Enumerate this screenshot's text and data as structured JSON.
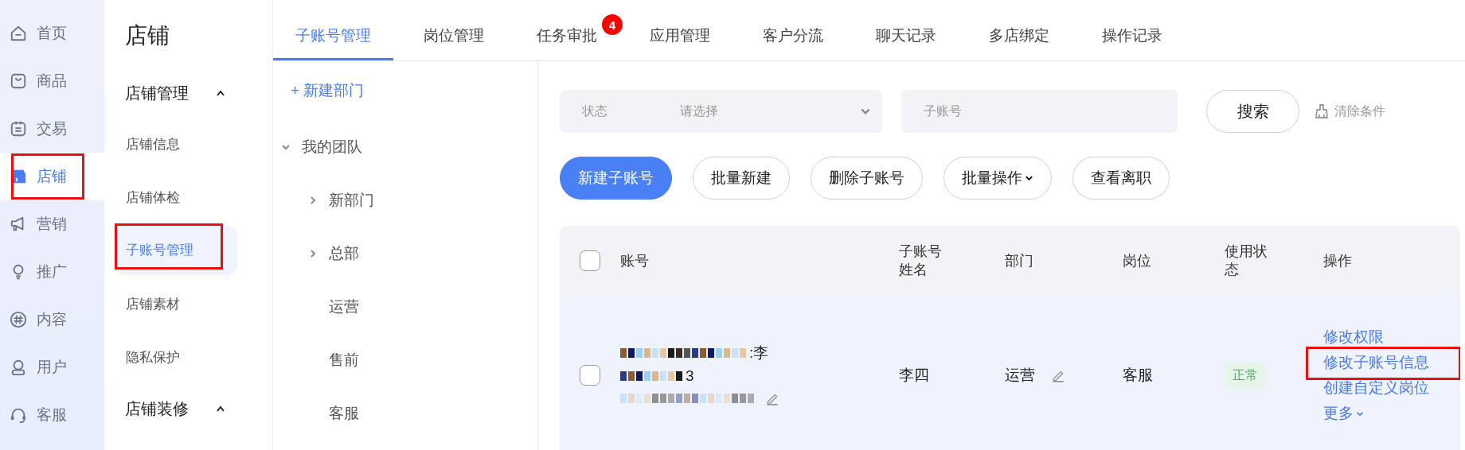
{
  "nav": [
    {
      "label": "首页",
      "selected": false,
      "highlighted": false
    },
    {
      "label": "商品",
      "selected": false,
      "highlighted": false
    },
    {
      "label": "交易",
      "selected": false,
      "highlighted": false
    },
    {
      "label": "店铺",
      "selected": true,
      "highlighted": true
    },
    {
      "label": "营销",
      "selected": false,
      "highlighted": false
    },
    {
      "label": "推广",
      "selected": false,
      "highlighted": false
    },
    {
      "label": "内容",
      "selected": false,
      "highlighted": false
    },
    {
      "label": "用户",
      "selected": false,
      "highlighted": false
    },
    {
      "label": "客服",
      "selected": false,
      "highlighted": false
    }
  ],
  "submenu": {
    "title": "店铺",
    "groups": [
      {
        "label": "店铺管理",
        "expanded": true,
        "items": [
          {
            "label": "店铺信息",
            "selected": false,
            "highlighted": false
          },
          {
            "label": "店铺体检",
            "selected": false,
            "highlighted": false
          },
          {
            "label": "子账号管理",
            "selected": true,
            "highlighted": true
          },
          {
            "label": "店铺素材",
            "selected": false,
            "highlighted": false
          },
          {
            "label": "隐私保护",
            "selected": false,
            "highlighted": false
          }
        ]
      },
      {
        "label": "店铺装修",
        "expanded": true
      }
    ]
  },
  "tabs": [
    {
      "label": "子账号管理",
      "selected": true
    },
    {
      "label": "岗位管理",
      "selected": false
    },
    {
      "label": "任务审批",
      "selected": false,
      "badge": "4"
    },
    {
      "label": "应用管理",
      "selected": false
    },
    {
      "label": "客户分流",
      "selected": false
    },
    {
      "label": "聊天记录",
      "selected": false
    },
    {
      "label": "多店绑定",
      "selected": false
    },
    {
      "label": "操作记录",
      "selected": false
    }
  ],
  "tree": {
    "add_label": "+ 新建部门",
    "root": {
      "label": "我的团队",
      "expanded": true,
      "children": [
        {
          "label": "新部门",
          "expandable": true
        },
        {
          "label": "总部",
          "expandable": true
        },
        {
          "label": "运营",
          "expandable": false
        },
        {
          "label": "售前",
          "expandable": false
        },
        {
          "label": "客服",
          "expandable": false
        }
      ]
    }
  },
  "filters": {
    "status_label": "状态",
    "status_placeholder": "请选择",
    "account_placeholder": "子账号",
    "search_button": "搜索",
    "clear_label": "清除条件"
  },
  "actions": [
    {
      "label": "新建子账号",
      "kind": "primary"
    },
    {
      "label": "批量新建",
      "kind": "default"
    },
    {
      "label": "删除子账号",
      "kind": "default"
    },
    {
      "label": "批量操作",
      "kind": "dropdown"
    },
    {
      "label": "查看离职",
      "kind": "default"
    }
  ],
  "table": {
    "columns": [
      "账号",
      "子账号姓名",
      "部门",
      "岗位",
      "使用状态",
      "操作"
    ],
    "header_checked": false,
    "rows": [
      {
        "checked": false,
        "account_line_1_tail": ":李",
        "account_line_2_tail": "3",
        "name": "李四",
        "department": "运营",
        "post": "客服",
        "status": "正常",
        "operations": [
          {
            "label": "修改权限",
            "highlighted": false,
            "kind": "link"
          },
          {
            "label": "修改子账号信息",
            "highlighted": true,
            "kind": "link"
          },
          {
            "label": "创建自定义岗位",
            "highlighted": false,
            "kind": "link"
          },
          {
            "label": "更多",
            "highlighted": false,
            "kind": "dropdown"
          }
        ]
      }
    ]
  }
}
